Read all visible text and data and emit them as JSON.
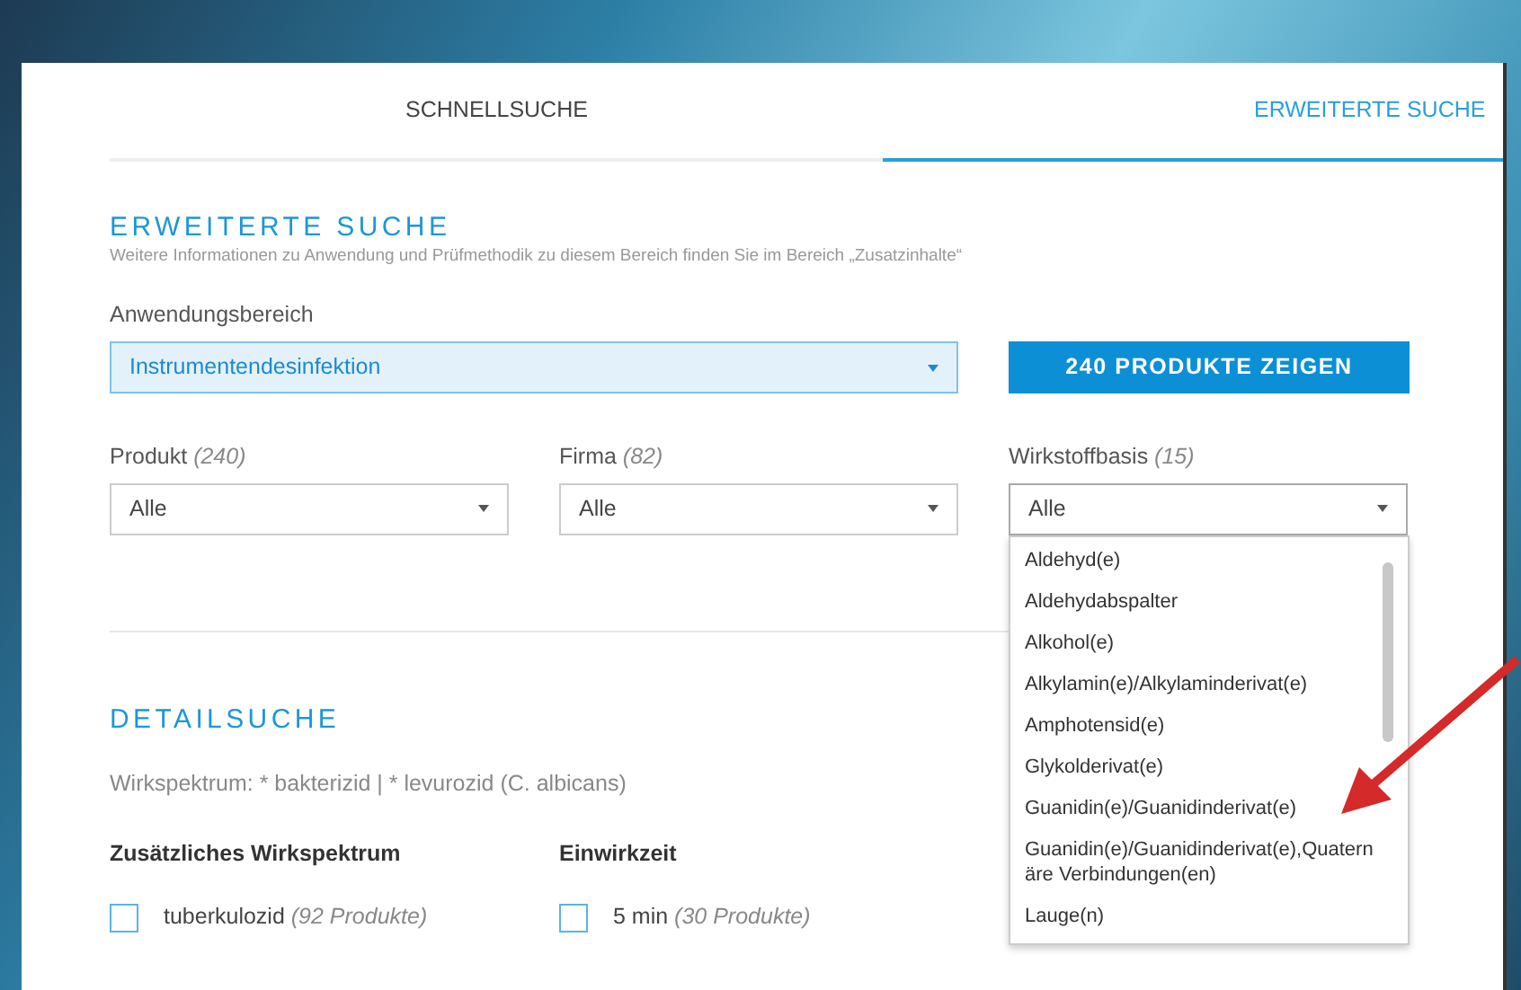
{
  "tabs": [
    {
      "label": "SCHNELLSUCHE",
      "selected": false
    },
    {
      "label": "ERWEITERTE SUCHE",
      "selected": true
    }
  ],
  "advanced": {
    "title": "ERWEITERTE SUCHE",
    "note": "Weitere Informationen zu Anwendung und Prüfmethodik zu diesem Bereich finden Sie im Bereich „Zusatzinhalte“",
    "area": {
      "label": "Anwendungsbereich",
      "value": "Instrumentendesinfektion"
    },
    "button": "240 PRODUKTE ZEIGEN"
  },
  "filters": [
    {
      "label": "Produkt",
      "count": "(240)",
      "value": "Alle",
      "expanded": false
    },
    {
      "label": "Firma",
      "count": "(82)",
      "value": "Alle",
      "expanded": false
    },
    {
      "label": "Wirkstoffbasis",
      "count": "(15)",
      "value": "Alle",
      "expanded": true,
      "options": [
        "Aldehyd(e)",
        "Aldehydabspalter",
        "Alkohol(e)",
        "Alkylamin(e)/Alkylaminderivat(e)",
        "Amphotensid(e)",
        "Glykolderivat(e)",
        "Guanidin(e)/Guanidinderivat(e)",
        "Guanidin(e)/Guanidinderivat(e),Quaternäre Verbindungen(en)",
        "Lauge(n)"
      ]
    }
  ],
  "detail": {
    "title": "DETAILSUCHE",
    "spectrum": "Wirkspektrum: * bakterizid | * levurozid (C. albicans)",
    "groups": [
      {
        "title": "Zusätzliches Wirkspektrum",
        "items": [
          {
            "label": "tuberkulozid",
            "count": "(92 Produkte)",
            "checked": false
          }
        ]
      },
      {
        "title": "Einwirkzeit",
        "items": [
          {
            "label": "5 min",
            "count": "(30 Produkte)",
            "checked": false
          }
        ]
      }
    ]
  }
}
